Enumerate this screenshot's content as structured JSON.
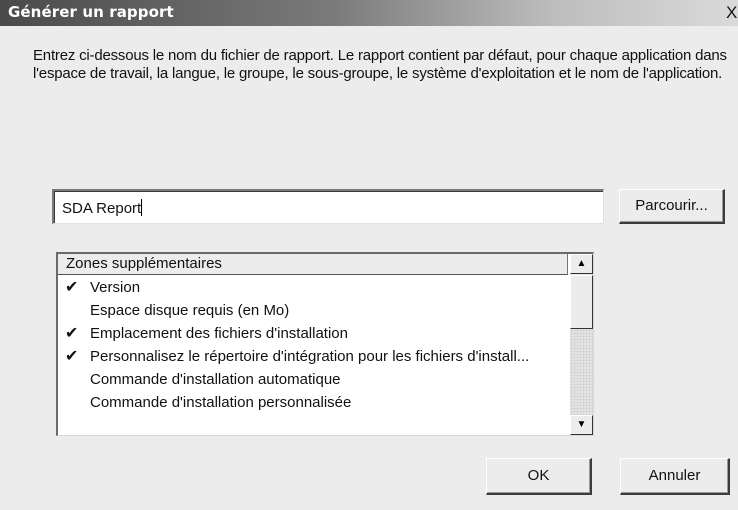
{
  "dialog": {
    "title": "Générer un rapport",
    "close_label": "X",
    "description": "Entrez ci-dessous le nom du fichier de rapport. Le rapport contient par défaut, pour chaque application dans l'espace de travail, la langue, le groupe, le sous-groupe, le système d'exploitation et le nom de l'application."
  },
  "report_name": {
    "value": "SDA Report"
  },
  "browse_button": "Parcourir...",
  "fields_list": {
    "header": "Zones supplémentaires",
    "items": [
      {
        "label": "Version",
        "checked": true
      },
      {
        "label": "Espace disque requis (en Mo)",
        "checked": false
      },
      {
        "label": "Emplacement des fichiers d'installation",
        "checked": true
      },
      {
        "label": "Personnalisez le répertoire d'intégration pour les fichiers d'install...",
        "checked": true
      },
      {
        "label": "Commande d'installation automatique",
        "checked": false
      },
      {
        "label": "Commande d'installation personnalisée",
        "checked": false
      }
    ]
  },
  "buttons": {
    "ok": "OK",
    "cancel": "Annuler"
  }
}
